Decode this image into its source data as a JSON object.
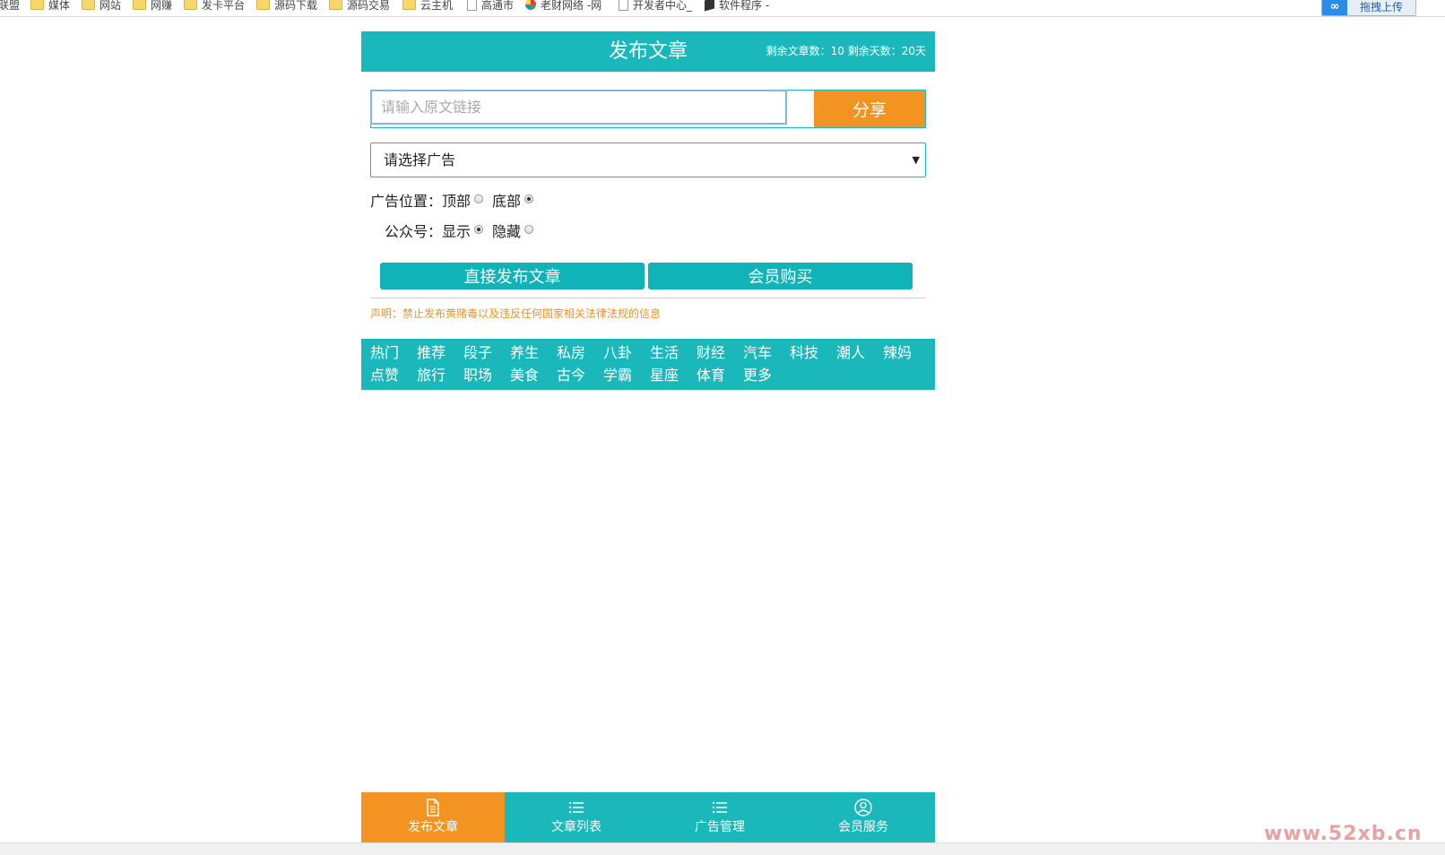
{
  "bookmarks": [
    "联盟",
    "媒体",
    "网站",
    "网赚",
    "发卡平台",
    "源码下载",
    "源码交易",
    "云主机",
    "高通市",
    "老财网络 -网",
    "开发者中心_",
    "软件程序 -"
  ],
  "upload_button": {
    "label": "拖拽上传"
  },
  "header": {
    "title": "发布文章",
    "stats": "剩余文章数：10 剩余天数：20天"
  },
  "url_form": {
    "placeholder": "请输入原文链接",
    "value": "",
    "share_label": "分享"
  },
  "ad_select": {
    "selected": "请选择广告"
  },
  "ad_position": {
    "label": "广告位置：",
    "options": [
      "顶部",
      "底部"
    ],
    "selected": "底部"
  },
  "official_account": {
    "label": "公众号：",
    "options": [
      "显示",
      "隐藏"
    ],
    "selected": "显示"
  },
  "actions": {
    "publish_label": "直接发布文章",
    "buy_label": "会员购买"
  },
  "disclaimer": "声明：禁止发布黄赌毒以及违反任何国家相关法律法规的信息",
  "categories": [
    "热门",
    "推荐",
    "段子",
    "养生",
    "私房",
    "八卦",
    "生活",
    "财经",
    "汽车",
    "科技",
    "潮人",
    "辣妈",
    "点赞",
    "旅行",
    "职场",
    "美食",
    "古今",
    "学霸",
    "星座",
    "体育",
    "更多"
  ],
  "bottom_nav": [
    {
      "label": "发布文章",
      "icon": "document-icon",
      "active": true
    },
    {
      "label": "文章列表",
      "icon": "list-icon",
      "active": false
    },
    {
      "label": "广告管理",
      "icon": "list-icon",
      "active": false
    },
    {
      "label": "会员服务",
      "icon": "user-icon",
      "active": false
    }
  ],
  "watermark": "www.52xb.cn",
  "colors": {
    "teal": "#1bb8bb",
    "orange": "#f39321"
  }
}
